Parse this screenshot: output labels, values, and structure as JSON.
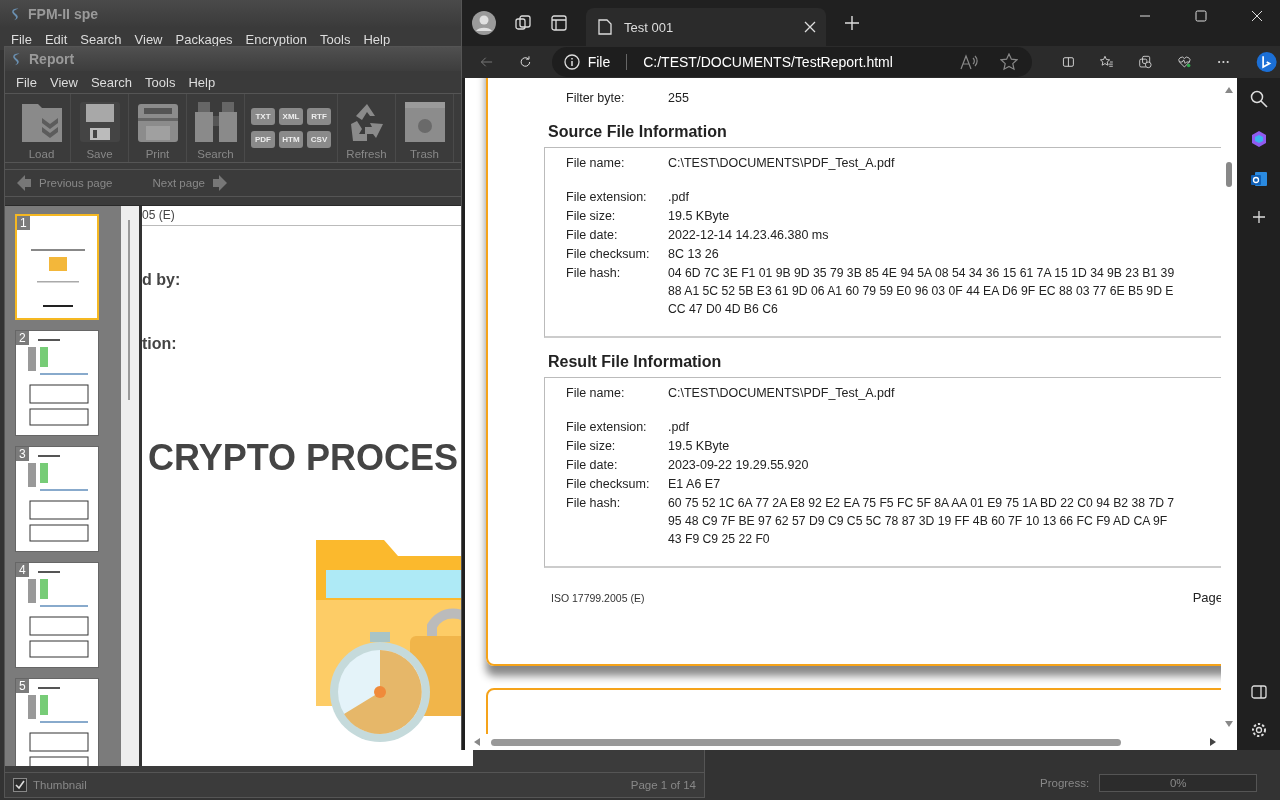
{
  "app": {
    "title": "FPM-II spe",
    "menu": [
      "File",
      "Edit",
      "Search",
      "View",
      "Packages",
      "Encryption",
      "Tools",
      "Help"
    ]
  },
  "report": {
    "title": "Report",
    "menu": [
      "File",
      "View",
      "Search",
      "Tools",
      "Help"
    ],
    "toolbar": [
      {
        "kind": "load",
        "label": "Load"
      },
      {
        "kind": "save",
        "label": "Save"
      },
      {
        "kind": "print",
        "label": "Print"
      },
      {
        "kind": "search",
        "label": "Search"
      },
      {
        "kind": "formats",
        "formats": [
          "TXT",
          "XML",
          "RTF",
          "PDF",
          "HTM",
          "CSV"
        ]
      },
      {
        "kind": "refresh",
        "label": "Refresh"
      },
      {
        "kind": "trash",
        "label": "Trash"
      }
    ],
    "nav": {
      "previous": "Previous page",
      "next": "Next page"
    },
    "thumbnails": [
      {
        "number": "1",
        "selected": true
      },
      {
        "number": "2",
        "selected": false
      },
      {
        "number": "3",
        "selected": false
      },
      {
        "number": "4",
        "selected": false
      },
      {
        "number": "5",
        "selected": false
      }
    ],
    "page": {
      "header": "05 (E)",
      "lines": [
        "d by:",
        "tion:"
      ],
      "title": "CRYPTO PROCES"
    },
    "thumbnail_toggle": {
      "label": "Thumbnail",
      "checked": true
    },
    "page_indicator": "Page 1 of 14"
  },
  "status": {
    "progress_label": "Progress:",
    "progress_text": "0%",
    "level": 0
  },
  "browser": {
    "tabs": [
      {
        "title": "Test 001",
        "selected": true
      }
    ],
    "address": {
      "scheme": "File",
      "url": "C:/TEST/DOCUMENTS/TestReport.html"
    },
    "document": {
      "top_rows": [
        {
          "label": "Filter byte:",
          "value": "255"
        }
      ],
      "sections": [
        {
          "title": "Source File Information",
          "rows": [
            {
              "label": "File name:",
              "value": "C:\\TEST\\DOCUMENTS\\PDF_Test_A.pdf"
            },
            {
              "label": "File extension:",
              "value": ".pdf"
            },
            {
              "label": "File size:",
              "value": "19.5 KByte"
            },
            {
              "label": "File date:",
              "value": "2022-12-14 14.23.46.380 ms"
            },
            {
              "label": "File checksum:",
              "value": "8C 13 26"
            },
            {
              "label": "File hash:",
              "lines": [
                "04 6D 7C 3E F1 01 9B 9D 35 79 3B 85 4E 94 5A 08 54 34 36 15 61 7A 15 1D 34 9B 23 B1 39",
                "88 A1 5C 52 5B E3 61 9D 06 A1 60 79 59 E0 96 03 0F 44 EA D6 9F EC 88 03 77 6E B5 9D E",
                "CC 47 D0 4D B6 C6"
              ]
            }
          ]
        },
        {
          "title": "Result File Information",
          "rows": [
            {
              "label": "File name:",
              "value": "C:\\TEST\\DOCUMENTS\\PDF_Test_A.pdf"
            },
            {
              "label": "File extension:",
              "value": ".pdf"
            },
            {
              "label": "File size:",
              "value": "19.5 KByte"
            },
            {
              "label": "File date:",
              "value": "2023-09-22 19.29.55.920"
            },
            {
              "label": "File checksum:",
              "value": "E1 A6 E7"
            },
            {
              "label": "File hash:",
              "lines": [
                "60 75 52 1C 6A 77 2A E8 92 E2 EA 75 F5 FC 5F 8A AA 01 E9 75 1A BD 22 C0 94 B2 38 7D 7",
                "95 48 C9 7F BE 97 62 57 D9 C9 C5 5C 78 87 3D 19 FF 4B 60 7F 10 13 66 FC F9 AD CA 9F",
                "43 F9 C9 25 22 F0"
              ]
            }
          ]
        }
      ],
      "footer": {
        "standard": "ISO 17799.2005 (E)",
        "page": "Page"
      }
    }
  }
}
